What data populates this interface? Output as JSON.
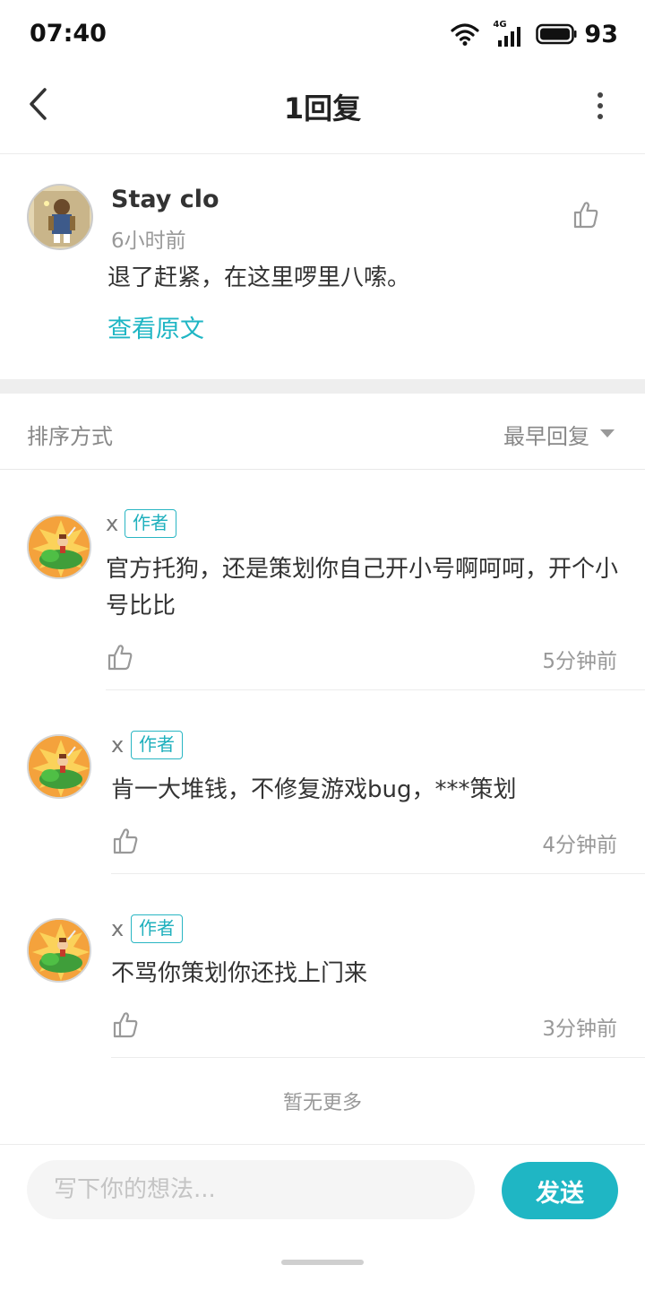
{
  "status_bar": {
    "time": "07:40",
    "network": "4G",
    "battery": "93",
    "icons": [
      "wifi-icon",
      "signal-icon",
      "battery-icon"
    ]
  },
  "header": {
    "title": "1回复",
    "back_icon": "chevron-left-icon",
    "more_icon": "more-vertical-icon"
  },
  "main_comment": {
    "author": "Stay clo",
    "time": "6小时前",
    "text": "退了赶紧，在这里啰里八嗦。",
    "view_original": "查看原文"
  },
  "sort": {
    "label": "排序方式",
    "value": "最早回复"
  },
  "replies": [
    {
      "author": "x",
      "badge": "作者",
      "text": "官方托狗，还是策划你自己开小号啊呵呵，开个小号比比",
      "time": "5分钟前"
    },
    {
      "author": "x",
      "badge": "作者",
      "text": "肯一大堆钱，不修复游戏bug，***策划",
      "time": "4分钟前"
    },
    {
      "author": "x",
      "badge": "作者",
      "text": "不骂你策划你还找上门来",
      "time": "3分钟前"
    }
  ],
  "footer_note": "暂无更多",
  "composer": {
    "placeholder": "写下你的想法...",
    "send_label": "发送"
  },
  "colors": {
    "accent": "#1fb6c4",
    "text": "#333333",
    "muted": "#999999"
  }
}
